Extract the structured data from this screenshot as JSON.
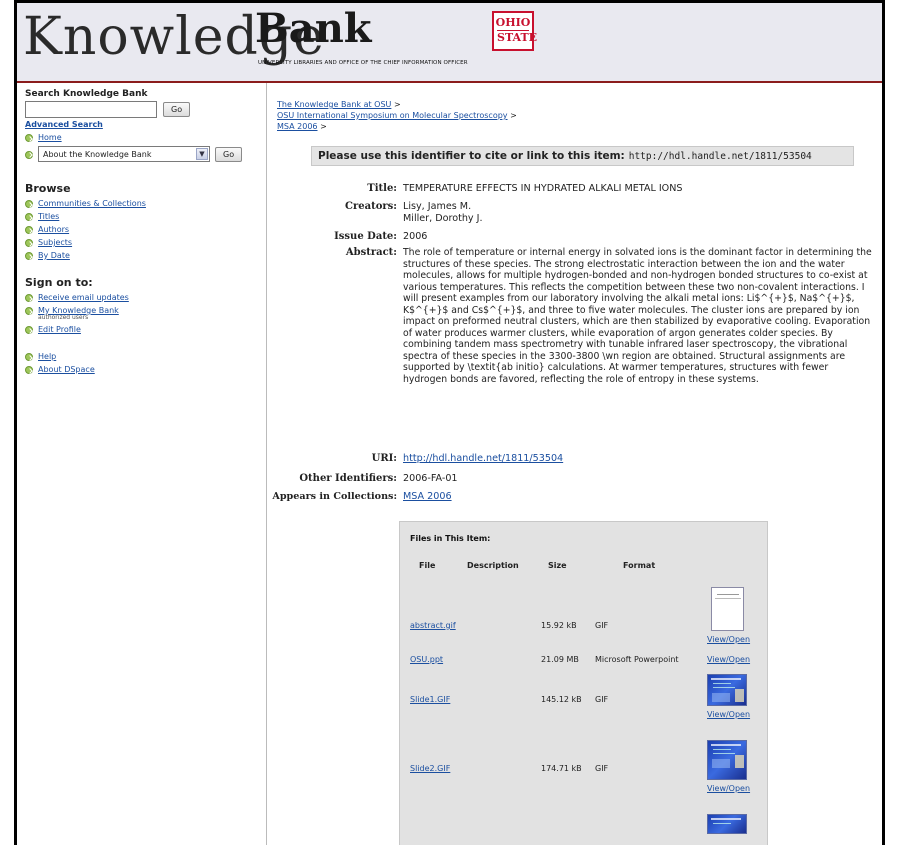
{
  "header": {
    "logo_knowledge": "Knowledge",
    "logo_bank": "Bank",
    "logo_subtitle": "UNIVERSITY LIBRARIES AND OFFICE OF THE CHIEF INFORMATION OFFICER",
    "osu_line1": "OHIO",
    "osu_line2": "STATE"
  },
  "sidebar": {
    "search_heading": "Search Knowledge Bank",
    "search_value": "",
    "go_label": "Go",
    "advanced_search": "Advanced Search",
    "home": "Home",
    "select_value": "About the Knowledge Bank",
    "select_go": "Go",
    "browse_heading": "Browse",
    "browse_items": [
      "Communities & Collections",
      "Titles",
      "Authors",
      "Subjects",
      "By Date"
    ],
    "signon_heading": "Sign on to:",
    "signon_items": [
      "Receive email updates",
      "My Knowledge Bank",
      "Edit Profile"
    ],
    "my_kb_note": "authorized users",
    "help": "Help",
    "about": "About DSpace"
  },
  "breadcrumb": {
    "item1": "The Knowledge Bank at OSU",
    "item2": "OSU International Symposium on Molecular Spectroscopy",
    "item3": "MSA 2006",
    "sep": ">"
  },
  "cite": {
    "text": "Please use this identifier to cite or link to this item:",
    "url": "http://hdl.handle.net/1811/53504"
  },
  "meta": {
    "title_label": "Title:",
    "title": "TEMPERATURE EFFECTS IN HYDRATED ALKALI METAL IONS",
    "creators_label": "Creators:",
    "creator1": "Lisy, James M.",
    "creator2": "Miller, Dorothy J.",
    "issue_label": "Issue Date:",
    "issue_date": "2006",
    "abstract_label": "Abstract:",
    "abstract": "The role of temperature or internal energy in solvated ions is the dominant factor in determining the structures of these species. The strong electrostatic interaction between the ion and the water molecules, allows for multiple hydrogen-bonded and non-hydrogen bonded structures to co-exist at various temperatures. This reflects the competition between these two non-covalent interactions. I will present examples from our laboratory involving the alkali metal ions: Li$^{+}$, Na$^{+}$, K$^{+}$ and Cs$^{+}$, and three to five water molecules. The cluster ions are prepared by ion impact on preformed neutral clusters, which are then stabilized by evaporative cooling. Evaporation of water produces warmer clusters, while evaporation of argon generates colder species. By combining tandem mass spectrometry with tunable infrared laser spectroscopy, the vibrational spectra of these species in the 3300-3800 \\wn region are obtained. Structural assignments are supported by \\textit{ab initio} calculations. At warmer temperatures, structures with fewer hydrogen bonds are favored, reflecting the role of entropy in these systems.",
    "uri_label": "URI:",
    "uri": "http://hdl.handle.net/1811/53504",
    "other_label": "Other Identifiers:",
    "other_ids": "2006-FA-01",
    "appears_label": "Appears in Collections:",
    "appears": "MSA 2006"
  },
  "files": {
    "heading": "Files in This Item:",
    "col_file": "File",
    "col_desc": "Description",
    "col_size": "Size",
    "col_format": "Format",
    "rows": [
      {
        "name": "abstract.gif",
        "size": "15.92 kB",
        "format": "GIF",
        "view": "View/Open"
      },
      {
        "name": "OSU.ppt",
        "size": "21.09 MB",
        "format": "Microsoft Powerpoint",
        "view": "View/Open"
      },
      {
        "name": "Slide1.GIF",
        "size": "145.12 kB",
        "format": "GIF",
        "view": "View/Open"
      },
      {
        "name": "Slide2.GIF",
        "size": "174.71 kB",
        "format": "GIF",
        "view": "View/Open"
      }
    ]
  },
  "colors": {
    "link": "#1b4fa0",
    "header_bg": "#e9e9f0",
    "header_rule": "#8b1c1c",
    "osu_red": "#c8102e",
    "files_bg": "#e2e2e2"
  }
}
